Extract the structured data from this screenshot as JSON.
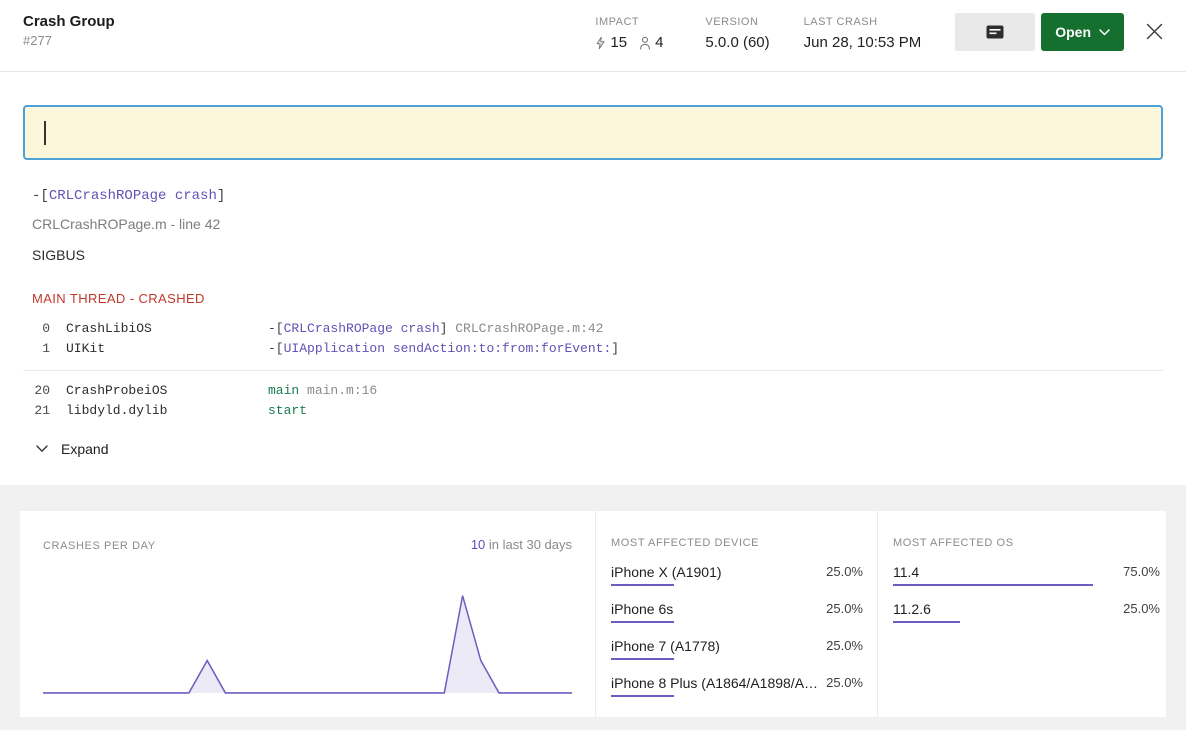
{
  "header": {
    "title": "Crash Group",
    "group_id": "#277",
    "impact_label": "IMPACT",
    "impact_crashes": "15",
    "impact_users": "4",
    "version_label": "VERSION",
    "version_value": "5.0.0 (60)",
    "last_crash_label": "LAST CRASH",
    "last_crash_value": "Jun 28, 10:53 PM",
    "open_button_label": "Open"
  },
  "note_box": {
    "value": ""
  },
  "crash_summary": {
    "signature": [
      {
        "text": "-[",
        "style": "plain"
      },
      {
        "text": "CRLCrashROPage crash",
        "style": "purple"
      },
      {
        "text": "]",
        "style": "plain"
      }
    ],
    "file_line": "CRLCrashROPage.m - line 42",
    "signal": "SIGBUS"
  },
  "thread": {
    "title": "MAIN THREAD - CRASHED",
    "frames_top": [
      {
        "index": "0",
        "module": "CrashLibiOS",
        "parts": [
          {
            "text": "-[",
            "style": "plain"
          },
          {
            "text": "CRLCrashROPage crash",
            "style": "purple"
          },
          {
            "text": "]",
            "style": "plain"
          },
          {
            "text": " CRLCrashROPage.m:42",
            "style": "muted"
          }
        ]
      },
      {
        "index": "1",
        "module": "UIKit",
        "parts": [
          {
            "text": "-[",
            "style": "plain"
          },
          {
            "text": "UIApplication sendAction:to:from:forEvent:",
            "style": "purple"
          },
          {
            "text": "]",
            "style": "plain"
          }
        ]
      }
    ],
    "frames_bottom": [
      {
        "index": "20",
        "module": "CrashProbeiOS",
        "parts": [
          {
            "text": "main",
            "style": "green"
          },
          {
            "text": " main.m:16",
            "style": "muted"
          }
        ]
      },
      {
        "index": "21",
        "module": "libdyld.dylib",
        "parts": [
          {
            "text": "start",
            "style": "green"
          }
        ]
      }
    ],
    "expand_label": "Expand"
  },
  "stats": {
    "crashes_per_day_label": "CRASHES PER DAY",
    "summary_count": "10",
    "summary_suffix": " in last 30 days",
    "device_panel_label": "MOST AFFECTED DEVICE",
    "devices": [
      {
        "name": "iPhone X (A1901)",
        "percent": "25.0%",
        "value": 25
      },
      {
        "name": "iPhone 6s",
        "percent": "25.0%",
        "value": 25
      },
      {
        "name": "iPhone 7 (A1778)",
        "percent": "25.0%",
        "value": 25
      },
      {
        "name": "iPhone 8 Plus (A1864/A1898/A…",
        "percent": "25.0%",
        "value": 25
      }
    ],
    "os_panel_label": "MOST AFFECTED OS",
    "os_versions": [
      {
        "name": "11.4",
        "percent": "75.0%",
        "value": 75
      },
      {
        "name": "11.2.6",
        "percent": "25.0%",
        "value": 25
      }
    ]
  },
  "chart_data": {
    "type": "area",
    "title": "Crashes per day",
    "total_label": "10 in last 30 days",
    "total": 10,
    "x_days": 30,
    "values": [
      0,
      0,
      0,
      0,
      0,
      0,
      0,
      0,
      0,
      2,
      0,
      0,
      0,
      0,
      0,
      0,
      0,
      0,
      0,
      0,
      0,
      0,
      0,
      6,
      2,
      0,
      0,
      0,
      0,
      0
    ],
    "ylim": [
      0,
      8
    ],
    "stroke_color": "#6a5fc1",
    "fill_color": "#edeaf8",
    "grid": false,
    "legend": false
  },
  "colors": {
    "accent_purple": "#6a5fc1",
    "code_purple": "#6252b5",
    "code_green": "#187a51",
    "crashed_red": "#c0392b",
    "open_green": "#156f2e",
    "note_bg": "#fcf6da",
    "note_border": "#4aa2d6",
    "section_bg": "#f1f1f2"
  }
}
